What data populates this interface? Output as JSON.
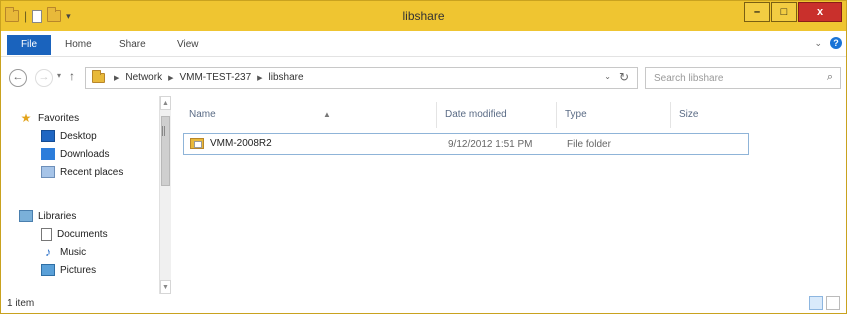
{
  "window": {
    "title": "libshare"
  },
  "title_controls": {
    "minimize": "–",
    "maximize": "□",
    "close": "x"
  },
  "ribbon": {
    "tabs": [
      "File",
      "Home",
      "Share",
      "View"
    ],
    "expand_glyph": "⌄",
    "help_glyph": "?"
  },
  "address": {
    "breadcrumbs": [
      "Network",
      "VMM-TEST-237",
      "libshare"
    ],
    "separator": "▶",
    "dropdown_glyph": "⌄",
    "refresh_glyph": "↻"
  },
  "nav": {
    "back_glyph": "←",
    "forward_glyph": "→",
    "recent_glyph": "▾",
    "up_glyph": "↑"
  },
  "search": {
    "placeholder": "Search libshare",
    "icon_glyph": "⌕"
  },
  "sidebar": {
    "favorites": {
      "label": "Favorites",
      "items": [
        "Desktop",
        "Downloads",
        "Recent places"
      ]
    },
    "libraries": {
      "label": "Libraries",
      "items": [
        "Documents",
        "Music",
        "Pictures"
      ]
    }
  },
  "columns": {
    "name": "Name",
    "date": "Date modified",
    "type": "Type",
    "size": "Size",
    "sort_glyph": "▲"
  },
  "files": [
    {
      "name": "VMM-2008R2",
      "date": "9/12/2012 1:51 PM",
      "type": "File folder",
      "size": ""
    }
  ],
  "status": {
    "item_count": "1 item"
  },
  "colors": {
    "titlebar": "#efc531",
    "file_tab": "#1a63bd",
    "close_button": "#c9302c",
    "selection_border": "#8fb4d8"
  },
  "icons": {
    "favorites": "star-icon",
    "desktop": "desktop-icon",
    "downloads": "downloads-icon",
    "recent": "recent-places-icon",
    "libraries": "libraries-icon",
    "documents": "documents-icon",
    "music": "music-icon",
    "pictures": "pictures-icon",
    "folder": "folder-icon"
  }
}
